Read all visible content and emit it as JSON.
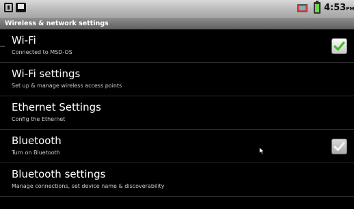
{
  "status_bar": {
    "time": "4:53",
    "ampm": "PM",
    "icons": [
      "usb-icon",
      "sd-card-icon",
      "gallery-notification-icon",
      "battery-icon"
    ]
  },
  "screen": {
    "title": "Wireless & network settings"
  },
  "settings": [
    {
      "title": "Wi-Fi",
      "summary": "Connected to MSD-OS",
      "checkbox": {
        "checked": true,
        "enabled": true
      }
    },
    {
      "title": "Wi-Fi settings",
      "summary": "Set up & manage wireless access points"
    },
    {
      "title": "Ethernet Settings",
      "summary": "Config the Ethernet"
    },
    {
      "title": "Bluetooth",
      "summary": "Turn on Bluetooth",
      "checkbox": {
        "checked": true,
        "enabled": false
      }
    },
    {
      "title": "Bluetooth settings",
      "summary": "Manage connections, set device name & discoverability"
    }
  ],
  "colors": {
    "check_enabled": "#3fbf1f",
    "check_disabled": "#f2f2f2",
    "background": "#000000"
  }
}
